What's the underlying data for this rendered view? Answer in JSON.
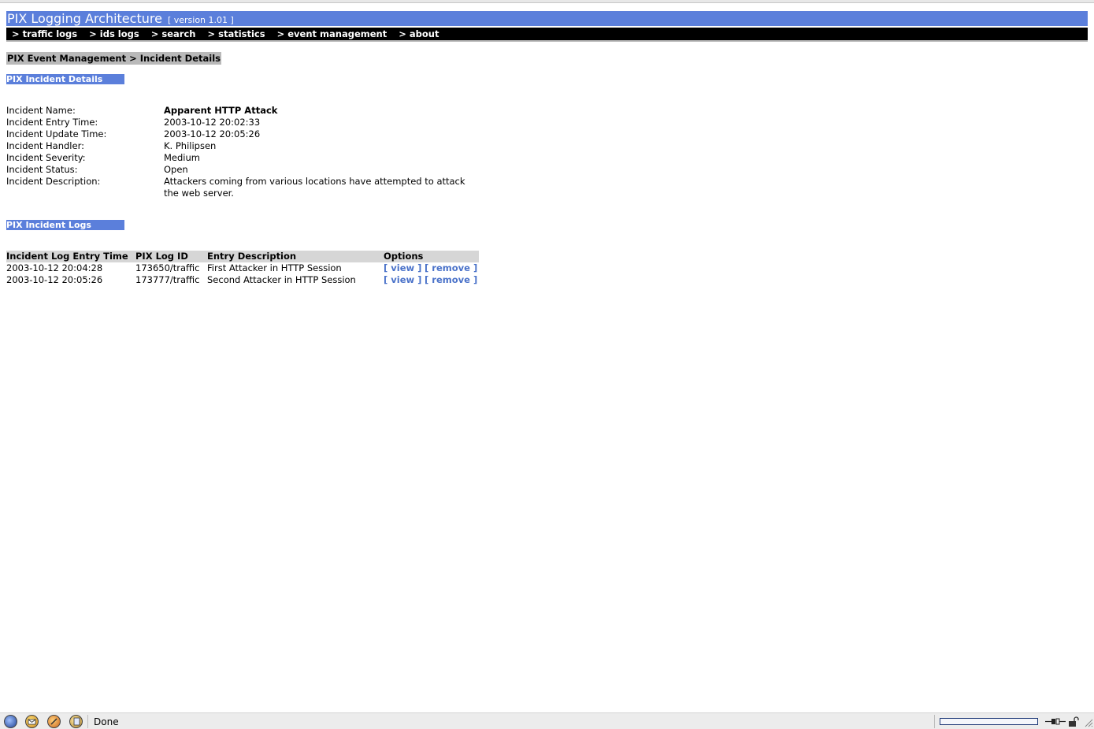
{
  "header": {
    "title": "PIX Logging Architecture",
    "version": "[ version 1.01 ]"
  },
  "nav": {
    "items": [
      "> traffic logs",
      "> ids logs",
      "> search",
      "> statistics",
      "> event management",
      "> about"
    ]
  },
  "breadcrumb": "PIX Event Management > Incident Details",
  "details_section": {
    "header": "PIX Incident Details",
    "fields": [
      {
        "label": "Incident Name:",
        "value": "Apparent HTTP Attack"
      },
      {
        "label": "Incident Entry Time:",
        "value": "2003-10-12 20:02:33"
      },
      {
        "label": "Incident Update Time:",
        "value": "2003-10-12 20:05:26"
      },
      {
        "label": "Incident Handler:",
        "value": "K. Philipsen"
      },
      {
        "label": "Incident Severity:",
        "value": "Medium"
      },
      {
        "label": "Incident Status:",
        "value": "Open"
      },
      {
        "label": "Incident Description:",
        "value": "Attackers coming from various locations have attempted to attack the web server."
      }
    ]
  },
  "logs_section": {
    "header": "PIX Incident Logs",
    "columns": [
      "Incident Log Entry Time",
      "PIX Log ID",
      "Entry Description",
      "Options"
    ],
    "rows": [
      {
        "time": "2003-10-12 20:04:28",
        "log_id": "173650/traffic",
        "description": "First Attacker in HTTP Session",
        "view": "[ view ]",
        "remove": "[ remove ]"
      },
      {
        "time": "2003-10-12 20:05:26",
        "log_id": "173777/traffic",
        "description": "Second Attacker in HTTP Session",
        "view": "[ view ]",
        "remove": "[ remove ]"
      }
    ]
  },
  "status_bar": {
    "text": "Done",
    "icons": [
      "navigator-icon",
      "mail-icon",
      "composer-icon",
      "address-book-icon"
    ],
    "progress": 0
  },
  "colors": {
    "header_blue": "#5b7fdb",
    "nav_black": "#000000",
    "link_blue": "#4a72c9"
  }
}
